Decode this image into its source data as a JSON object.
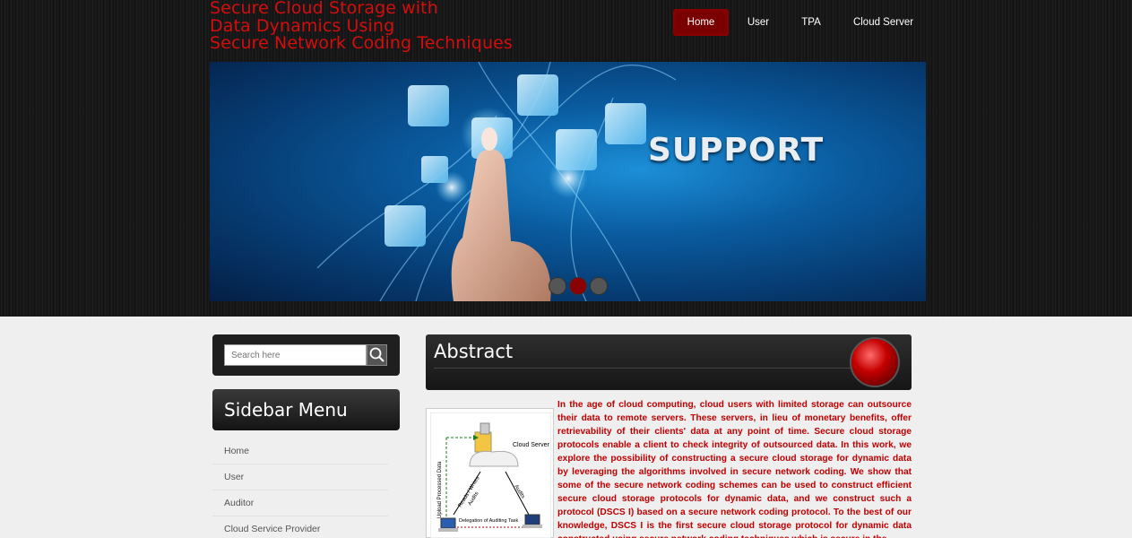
{
  "header": {
    "title_lines": [
      "Secure Cloud Storage with",
      "Data Dynamics Using",
      "Secure Network Coding Techniques"
    ],
    "nav": [
      "Home",
      "User",
      "TPA",
      "Cloud Server"
    ],
    "active_nav": "Home"
  },
  "banner": {
    "text": "SUPPORT",
    "slides": 3,
    "active_slide": 2
  },
  "sidebar": {
    "search_placeholder": "Search here",
    "menu_title": "Sidebar Menu",
    "items": [
      "Home",
      "User",
      "Auditor",
      "Cloud Service Provider"
    ]
  },
  "main": {
    "heading": "Abstract",
    "figure": {
      "cloud_label": "Cloud Server",
      "left_label": "Upload Processed Data",
      "center_label": "Reads / Writes",
      "audits_label_1": "Audits",
      "audits_label_2": "Audits",
      "bottom_label": "Delegation of Auditing Task"
    },
    "abstract_text": "In the age of cloud computing, cloud users with limited storage can outsource their data to remote servers. These servers, in lieu of monetary benefits, offer retrievability of their clients' data at any point of time. Secure cloud storage protocols enable a client to check integrity of outsourced data. In this work, we explore the possibility of constructing a secure cloud storage for dynamic data by leveraging the algorithms involved in secure network coding. We show that some of the secure network coding schemes can be used to construct efficient secure cloud storage protocols for dynamic data, and we construct such a protocol (DSCS I) based on a secure network coding protocol. To the best of our knowledge, DSCS I is the first secure cloud storage protocol for dynamic data constructed using secure network coding techniques which is secure in the"
  },
  "colors": {
    "accent_red": "#d40d0d",
    "nav_active": "#7a0000",
    "abstract_text": "#c00000"
  }
}
